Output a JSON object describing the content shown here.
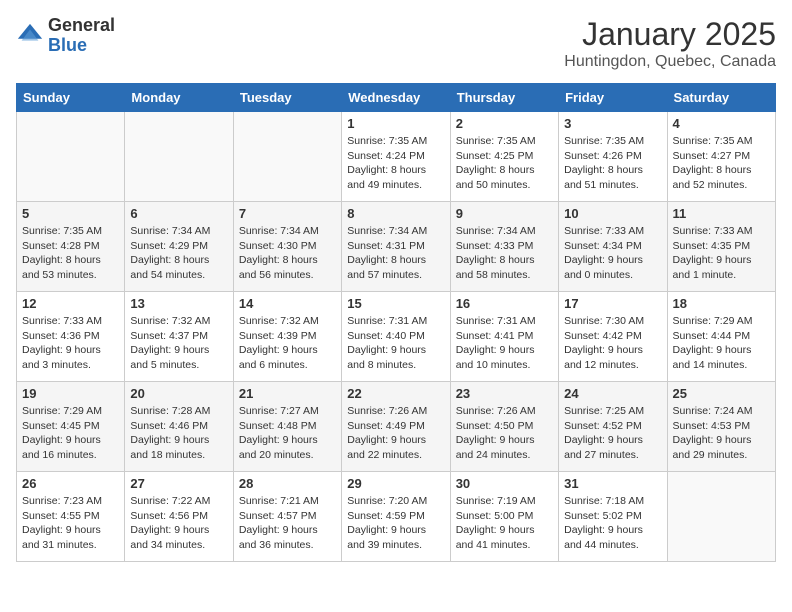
{
  "logo": {
    "general": "General",
    "blue": "Blue"
  },
  "header": {
    "month": "January 2025",
    "location": "Huntingdon, Quebec, Canada"
  },
  "weekdays": [
    "Sunday",
    "Monday",
    "Tuesday",
    "Wednesday",
    "Thursday",
    "Friday",
    "Saturday"
  ],
  "weeks": [
    [
      {
        "day": "",
        "info": ""
      },
      {
        "day": "",
        "info": ""
      },
      {
        "day": "",
        "info": ""
      },
      {
        "day": "1",
        "info": "Sunrise: 7:35 AM\nSunset: 4:24 PM\nDaylight: 8 hours\nand 49 minutes."
      },
      {
        "day": "2",
        "info": "Sunrise: 7:35 AM\nSunset: 4:25 PM\nDaylight: 8 hours\nand 50 minutes."
      },
      {
        "day": "3",
        "info": "Sunrise: 7:35 AM\nSunset: 4:26 PM\nDaylight: 8 hours\nand 51 minutes."
      },
      {
        "day": "4",
        "info": "Sunrise: 7:35 AM\nSunset: 4:27 PM\nDaylight: 8 hours\nand 52 minutes."
      }
    ],
    [
      {
        "day": "5",
        "info": "Sunrise: 7:35 AM\nSunset: 4:28 PM\nDaylight: 8 hours\nand 53 minutes."
      },
      {
        "day": "6",
        "info": "Sunrise: 7:34 AM\nSunset: 4:29 PM\nDaylight: 8 hours\nand 54 minutes."
      },
      {
        "day": "7",
        "info": "Sunrise: 7:34 AM\nSunset: 4:30 PM\nDaylight: 8 hours\nand 56 minutes."
      },
      {
        "day": "8",
        "info": "Sunrise: 7:34 AM\nSunset: 4:31 PM\nDaylight: 8 hours\nand 57 minutes."
      },
      {
        "day": "9",
        "info": "Sunrise: 7:34 AM\nSunset: 4:33 PM\nDaylight: 8 hours\nand 58 minutes."
      },
      {
        "day": "10",
        "info": "Sunrise: 7:33 AM\nSunset: 4:34 PM\nDaylight: 9 hours\nand 0 minutes."
      },
      {
        "day": "11",
        "info": "Sunrise: 7:33 AM\nSunset: 4:35 PM\nDaylight: 9 hours\nand 1 minute."
      }
    ],
    [
      {
        "day": "12",
        "info": "Sunrise: 7:33 AM\nSunset: 4:36 PM\nDaylight: 9 hours\nand 3 minutes."
      },
      {
        "day": "13",
        "info": "Sunrise: 7:32 AM\nSunset: 4:37 PM\nDaylight: 9 hours\nand 5 minutes."
      },
      {
        "day": "14",
        "info": "Sunrise: 7:32 AM\nSunset: 4:39 PM\nDaylight: 9 hours\nand 6 minutes."
      },
      {
        "day": "15",
        "info": "Sunrise: 7:31 AM\nSunset: 4:40 PM\nDaylight: 9 hours\nand 8 minutes."
      },
      {
        "day": "16",
        "info": "Sunrise: 7:31 AM\nSunset: 4:41 PM\nDaylight: 9 hours\nand 10 minutes."
      },
      {
        "day": "17",
        "info": "Sunrise: 7:30 AM\nSunset: 4:42 PM\nDaylight: 9 hours\nand 12 minutes."
      },
      {
        "day": "18",
        "info": "Sunrise: 7:29 AM\nSunset: 4:44 PM\nDaylight: 9 hours\nand 14 minutes."
      }
    ],
    [
      {
        "day": "19",
        "info": "Sunrise: 7:29 AM\nSunset: 4:45 PM\nDaylight: 9 hours\nand 16 minutes."
      },
      {
        "day": "20",
        "info": "Sunrise: 7:28 AM\nSunset: 4:46 PM\nDaylight: 9 hours\nand 18 minutes."
      },
      {
        "day": "21",
        "info": "Sunrise: 7:27 AM\nSunset: 4:48 PM\nDaylight: 9 hours\nand 20 minutes."
      },
      {
        "day": "22",
        "info": "Sunrise: 7:26 AM\nSunset: 4:49 PM\nDaylight: 9 hours\nand 22 minutes."
      },
      {
        "day": "23",
        "info": "Sunrise: 7:26 AM\nSunset: 4:50 PM\nDaylight: 9 hours\nand 24 minutes."
      },
      {
        "day": "24",
        "info": "Sunrise: 7:25 AM\nSunset: 4:52 PM\nDaylight: 9 hours\nand 27 minutes."
      },
      {
        "day": "25",
        "info": "Sunrise: 7:24 AM\nSunset: 4:53 PM\nDaylight: 9 hours\nand 29 minutes."
      }
    ],
    [
      {
        "day": "26",
        "info": "Sunrise: 7:23 AM\nSunset: 4:55 PM\nDaylight: 9 hours\nand 31 minutes."
      },
      {
        "day": "27",
        "info": "Sunrise: 7:22 AM\nSunset: 4:56 PM\nDaylight: 9 hours\nand 34 minutes."
      },
      {
        "day": "28",
        "info": "Sunrise: 7:21 AM\nSunset: 4:57 PM\nDaylight: 9 hours\nand 36 minutes."
      },
      {
        "day": "29",
        "info": "Sunrise: 7:20 AM\nSunset: 4:59 PM\nDaylight: 9 hours\nand 39 minutes."
      },
      {
        "day": "30",
        "info": "Sunrise: 7:19 AM\nSunset: 5:00 PM\nDaylight: 9 hours\nand 41 minutes."
      },
      {
        "day": "31",
        "info": "Sunrise: 7:18 AM\nSunset: 5:02 PM\nDaylight: 9 hours\nand 44 minutes."
      },
      {
        "day": "",
        "info": ""
      }
    ]
  ]
}
